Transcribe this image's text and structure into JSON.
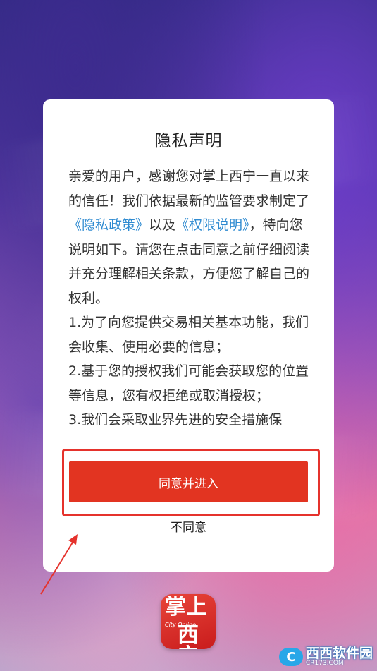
{
  "dialog": {
    "title": "隐私声明",
    "body": {
      "p1_a": "亲爱的用户，感谢您对掌上西宁一直以来的信任！我们依据最新的监管要求制定了",
      "link_privacy": "《隐私政策》",
      "p1_b": "以及",
      "link_permission": "《权限说明》",
      "p1_c": "，特向您说明如下。请您在点击同意之前仔细阅读并充分理解相关条款，方便您了解自己的权利。",
      "item1": "1.为了向您提供交易相关基本功能，我们会收集、使用必要的信息；",
      "item2": "2.基于您的授权我们可能会获取您的位置等信息，您有权拒绝或取消授权；",
      "item3": "3.我们会采取业界先进的安全措施保"
    },
    "agree_label": "同意并进入",
    "decline_label": "不同意"
  },
  "app_logo": {
    "top_text": "掌上",
    "mid_text": "City Online",
    "bottom_text": "西宁"
  },
  "watermark": {
    "icon_glyph": "C",
    "main_text": "西西软件园",
    "sub_text": "CR173.COM"
  },
  "colors": {
    "accent": "#e23421",
    "link": "#2f8bd1",
    "highlight": "#e5322c"
  }
}
